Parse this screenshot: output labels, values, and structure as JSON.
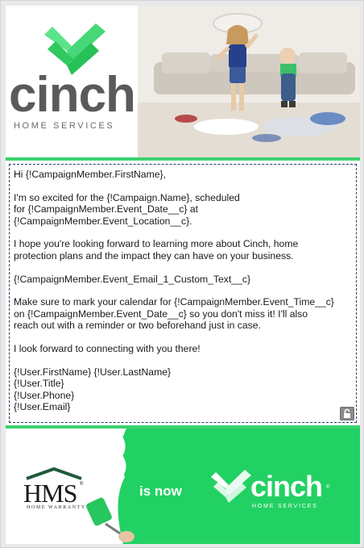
{
  "brand": {
    "logo_word": "cinch",
    "logo_sub": "HOME SERVICES",
    "reg_mark": "®",
    "accent_color": "#3bd16f",
    "banner_color": "#22d163"
  },
  "email": {
    "greeting": "Hi {!CampaignMember.FirstName},",
    "p1_line1": "I'm so excited for the {!Campaign.Name}, scheduled",
    "p1_line2": "for {!CampaignMember.Event_Date__c} at",
    "p1_line3": "{!CampaignMember.Event_Location__c}.",
    "p2_line1": "I hope you're looking forward to learning more about Cinch, home",
    "p2_line2": "protection plans and the impact they can have on your business.",
    "p3": "{!CampaignMember.Event_Email_1_Custom_Text__c}",
    "p4_line1": "Make sure to mark your calendar for {!CampaignMember.Event_Time__c}",
    "p4_line2": "on  {!CampaignMember.Event_Date__c} so you don't miss it! I'll also",
    "p4_line3": "reach out with a reminder or two beforehand just in case.",
    "p5": "I look forward to connecting with you there!",
    "sig_name": "{!User.FirstName} {!User.LastName}",
    "sig_title": "{!User.Title}",
    "sig_phone": "{!User.Phone}",
    "sig_email": "{!User.Email}",
    "lock_icon": "lock-icon"
  },
  "footer": {
    "hms_word": "HMS",
    "hms_reg": "®",
    "hms_sub": "HOME WARRANTY",
    "is_now": "is now",
    "cinch_word": "cinch",
    "cinch_reg": "®",
    "cinch_sub": "HOME SERVICES"
  }
}
